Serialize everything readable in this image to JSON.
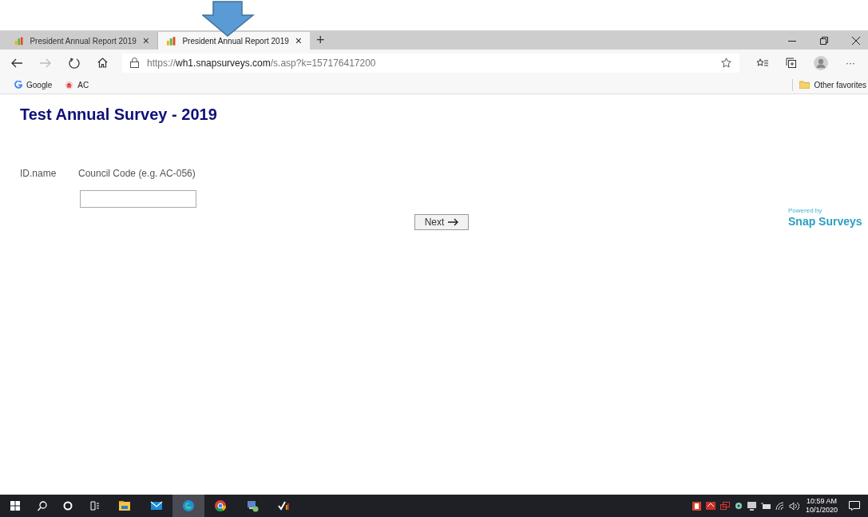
{
  "tabs": [
    {
      "title": "President Annual Report 2019",
      "close": "×",
      "selected": false
    },
    {
      "title": "President Annual Report 2019",
      "close": "×",
      "selected": true
    }
  ],
  "new_tab": "+",
  "address_bar": {
    "scheme": "https://",
    "host": "wh1.snapsurveys.com",
    "path": "/s.asp?k=157176417200"
  },
  "bookmarks": [
    {
      "label": "Google",
      "kind": "google"
    },
    {
      "label": "AC",
      "kind": "ac"
    }
  ],
  "other_favorites": "Other favorites",
  "more": "···",
  "page": {
    "title": "Test Annual Survey - 2019",
    "id_label": "ID.name",
    "question": "Council Code (e.g. AC-056)",
    "next_button": "Next",
    "powered_by": "Powered by",
    "brand": "Snap Surveys"
  },
  "taskbar": {
    "apps": [
      {
        "kind": "explorer",
        "selected": false
      },
      {
        "kind": "mail",
        "selected": false
      },
      {
        "kind": "edge",
        "selected": true
      },
      {
        "kind": "chrome",
        "selected": false
      },
      {
        "kind": "network",
        "selected": false
      },
      {
        "kind": "check",
        "selected": false
      }
    ],
    "time": "10:59 AM",
    "date": "10/1/2020"
  }
}
